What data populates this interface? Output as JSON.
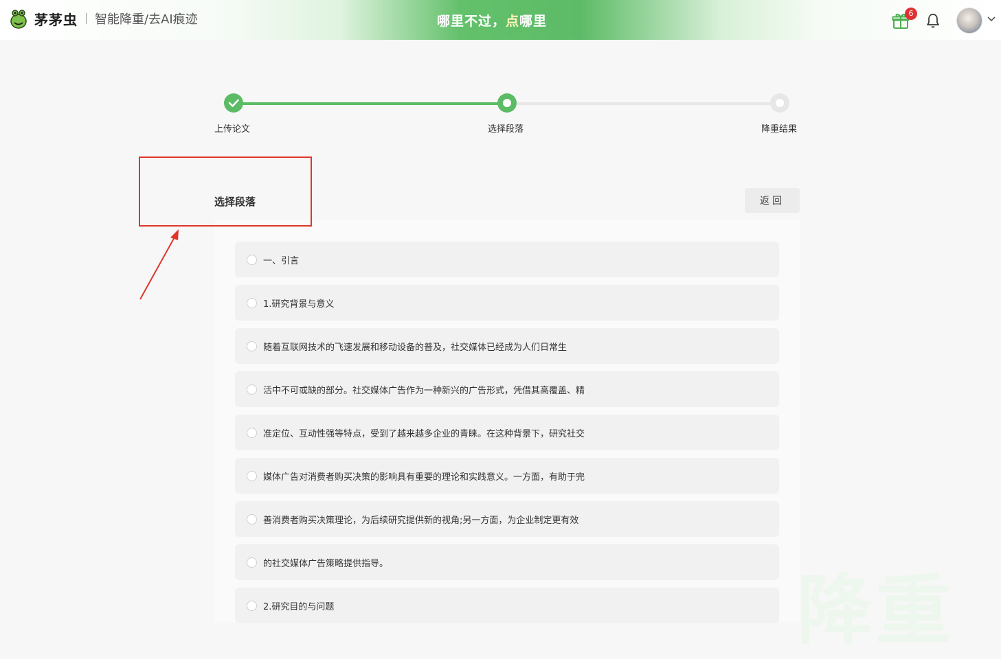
{
  "header": {
    "brand": "茅茅虫",
    "subtitle": "智能降重/去AI痕迹",
    "slogan_part1": "哪里不过，",
    "slogan_part2": "点",
    "slogan_part3": "哪里",
    "gift_badge_count": "6",
    "icons": [
      "gift-icon",
      "bell-icon",
      "chevron-down-icon"
    ]
  },
  "steps": {
    "step1": "上传论文",
    "step2": "选择段落",
    "step3": "降重结果"
  },
  "section": {
    "title": "选择段落",
    "back_label": "返回"
  },
  "paragraphs": [
    "一、引言",
    "1.研究背景与意义",
    "随着互联网技术的飞速发展和移动设备的普及，社交媒体已经成为人们日常生",
    "活中不可或缺的部分。社交媒体广告作为一种新兴的广告形式，凭借其高覆盖、精",
    "准定位、互动性强等特点，受到了越来越多企业的青睐。在这种背景下，研究社交",
    "媒体广告对消费者购买决策的影响具有重要的理论和实践意义。一方面，有助于完",
    "善消费者购买决策理论，为后续研究提供新的视角;另一方面，为企业制定更有效",
    "的社交媒体广告策略提供指导。",
    "2.研究目的与问题"
  ],
  "watermark": "降重",
  "colors": {
    "accent": "#5cbc66",
    "annotation": "#e0352b",
    "badge": "#e03232"
  }
}
